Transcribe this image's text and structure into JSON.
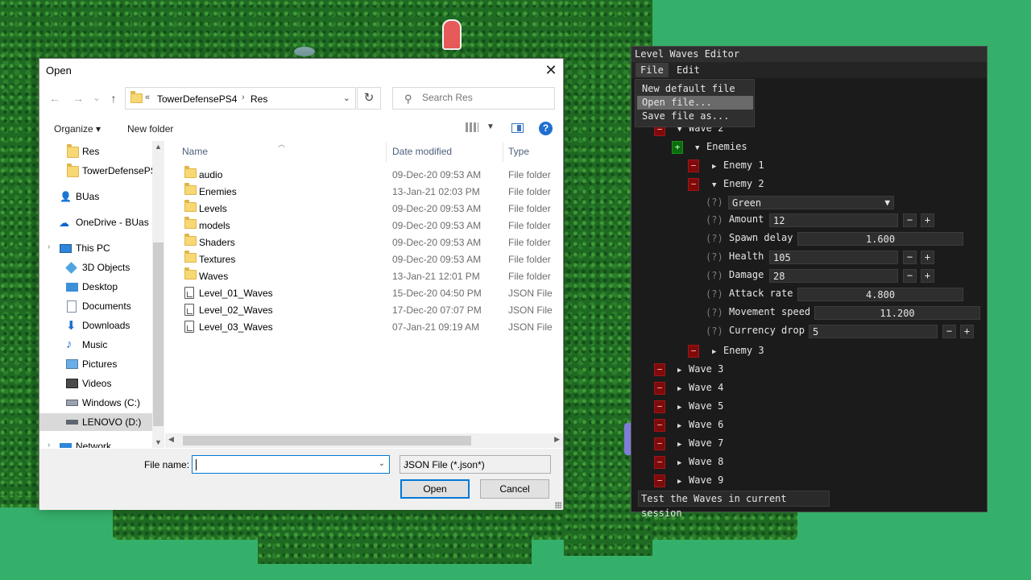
{
  "dialog": {
    "title": "Open",
    "close_glyph": "✕",
    "nav": {
      "back": "←",
      "forward": "→",
      "recent": "⌄",
      "up": "↑"
    },
    "address": {
      "overflow": "«",
      "crumbs": [
        "TowerDefensePS4",
        "Res"
      ],
      "separator": "›",
      "dropdown": "⌄"
    },
    "refresh_glyph": "↻",
    "search": {
      "placeholder": "Search Res",
      "icon": "search-icon"
    },
    "toolbar": {
      "organize": "Organize ▾",
      "new_folder": "New folder",
      "help": "?"
    },
    "nav_pane": [
      {
        "label": "Res",
        "icon": "folder-icon",
        "selected": false
      },
      {
        "label": "TowerDefensePS",
        "icon": "folder-icon",
        "selected": false
      },
      {
        "label": "BUas",
        "icon": "user-icon",
        "selected": false
      },
      {
        "label": "OneDrive - BUas",
        "icon": "cloud-icon",
        "selected": false
      },
      {
        "label": "This PC",
        "icon": "pc-icon",
        "selected": false
      },
      {
        "label": "3D Objects",
        "icon": "cube-icon",
        "selected": false
      },
      {
        "label": "Desktop",
        "icon": "desktop-icon",
        "selected": false
      },
      {
        "label": "Documents",
        "icon": "documents-icon",
        "selected": false
      },
      {
        "label": "Downloads",
        "icon": "download-icon",
        "selected": false
      },
      {
        "label": "Music",
        "icon": "music-icon",
        "selected": false
      },
      {
        "label": "Pictures",
        "icon": "pictures-icon",
        "selected": false
      },
      {
        "label": "Videos",
        "icon": "videos-icon",
        "selected": false
      },
      {
        "label": "Windows (C:)",
        "icon": "drive-icon",
        "selected": false
      },
      {
        "label": "LENOVO (D:)",
        "icon": "drive-icon",
        "selected": true
      },
      {
        "label": "Network",
        "icon": "network-icon",
        "selected": false
      }
    ],
    "columns": {
      "name": "Name",
      "date": "Date modified",
      "type": "Type"
    },
    "files": [
      {
        "name": "audio",
        "date": "09-Dec-20 09:53 AM",
        "type": "File folder",
        "kind": "folder"
      },
      {
        "name": "Enemies",
        "date": "13-Jan-21 02:03 PM",
        "type": "File folder",
        "kind": "folder"
      },
      {
        "name": "Levels",
        "date": "09-Dec-20 09:53 AM",
        "type": "File folder",
        "kind": "folder"
      },
      {
        "name": "models",
        "date": "09-Dec-20 09:53 AM",
        "type": "File folder",
        "kind": "folder"
      },
      {
        "name": "Shaders",
        "date": "09-Dec-20 09:53 AM",
        "type": "File folder",
        "kind": "folder"
      },
      {
        "name": "Textures",
        "date": "09-Dec-20 09:53 AM",
        "type": "File folder",
        "kind": "folder"
      },
      {
        "name": "Waves",
        "date": "13-Jan-21 12:01 PM",
        "type": "File folder",
        "kind": "folder"
      },
      {
        "name": "Level_01_Waves",
        "date": "15-Dec-20 04:50 PM",
        "type": "JSON File",
        "kind": "json"
      },
      {
        "name": "Level_02_Waves",
        "date": "17-Dec-20 07:07 PM",
        "type": "JSON File",
        "kind": "json"
      },
      {
        "name": "Level_03_Waves",
        "date": "07-Jan-21 09:19 AM",
        "type": "JSON File",
        "kind": "json"
      }
    ],
    "file_name_label": "File name:",
    "file_name_value": "",
    "file_type": "JSON File (*.json*)",
    "open_button": "Open",
    "cancel_button": "Cancel"
  },
  "editor": {
    "title": "Level Waves Editor",
    "menus": [
      "File",
      "Edit"
    ],
    "file_menu_items": [
      "New default file",
      "Open file...",
      "Save file as..."
    ],
    "highlighted_item": "Open file...",
    "wave2_label": "Wave 2",
    "enemies_label": "Enemies",
    "enemy1_label": "Enemy 1",
    "enemy2_label": "Enemy 2",
    "enemy3_label": "Enemy 3",
    "remove_glyph": "−",
    "add_glyph": "+",
    "help_marker": "(?)",
    "enemy_type": "Green",
    "props": {
      "amount": {
        "label": "Amount",
        "value": "12"
      },
      "spawn_delay": {
        "label": "Spawn delay",
        "value": "1.600"
      },
      "health": {
        "label": "Health",
        "value": "105"
      },
      "damage": {
        "label": "Damage",
        "value": "28"
      },
      "attack_rate": {
        "label": "Attack rate",
        "value": "4.800"
      },
      "movement_speed": {
        "label": "Movement speed",
        "value": "11.200"
      },
      "currency_drop": {
        "label": "Currency drop",
        "value": "5"
      }
    },
    "waves": [
      "Wave 3",
      "Wave 4",
      "Wave 5",
      "Wave 6",
      "Wave 7",
      "Wave 8",
      "Wave 9"
    ],
    "test_button": "Test the Waves in current session"
  }
}
